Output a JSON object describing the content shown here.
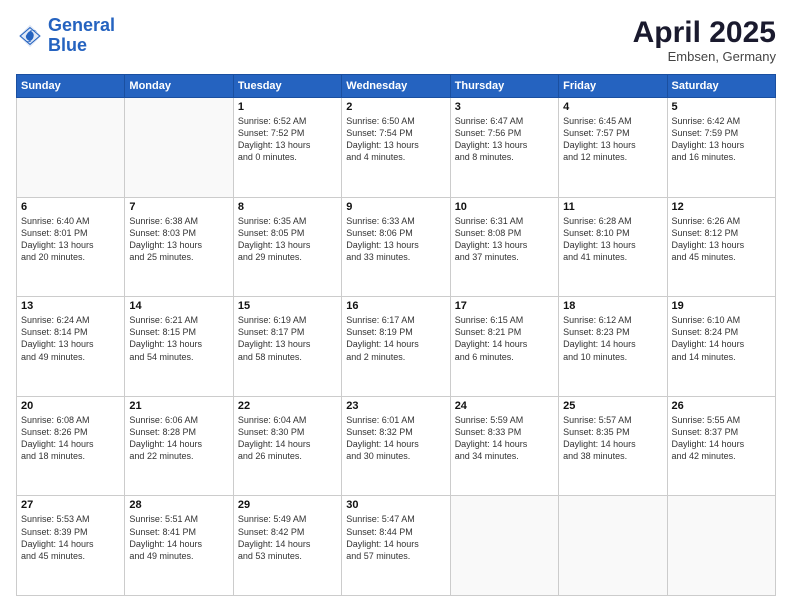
{
  "header": {
    "logo_line1": "General",
    "logo_line2": "Blue",
    "month": "April 2025",
    "location": "Embsen, Germany"
  },
  "weekdays": [
    "Sunday",
    "Monday",
    "Tuesday",
    "Wednesday",
    "Thursday",
    "Friday",
    "Saturday"
  ],
  "weeks": [
    [
      {
        "day": "",
        "info": ""
      },
      {
        "day": "",
        "info": ""
      },
      {
        "day": "1",
        "info": "Sunrise: 6:52 AM\nSunset: 7:52 PM\nDaylight: 13 hours\nand 0 minutes."
      },
      {
        "day": "2",
        "info": "Sunrise: 6:50 AM\nSunset: 7:54 PM\nDaylight: 13 hours\nand 4 minutes."
      },
      {
        "day": "3",
        "info": "Sunrise: 6:47 AM\nSunset: 7:56 PM\nDaylight: 13 hours\nand 8 minutes."
      },
      {
        "day": "4",
        "info": "Sunrise: 6:45 AM\nSunset: 7:57 PM\nDaylight: 13 hours\nand 12 minutes."
      },
      {
        "day": "5",
        "info": "Sunrise: 6:42 AM\nSunset: 7:59 PM\nDaylight: 13 hours\nand 16 minutes."
      }
    ],
    [
      {
        "day": "6",
        "info": "Sunrise: 6:40 AM\nSunset: 8:01 PM\nDaylight: 13 hours\nand 20 minutes."
      },
      {
        "day": "7",
        "info": "Sunrise: 6:38 AM\nSunset: 8:03 PM\nDaylight: 13 hours\nand 25 minutes."
      },
      {
        "day": "8",
        "info": "Sunrise: 6:35 AM\nSunset: 8:05 PM\nDaylight: 13 hours\nand 29 minutes."
      },
      {
        "day": "9",
        "info": "Sunrise: 6:33 AM\nSunset: 8:06 PM\nDaylight: 13 hours\nand 33 minutes."
      },
      {
        "day": "10",
        "info": "Sunrise: 6:31 AM\nSunset: 8:08 PM\nDaylight: 13 hours\nand 37 minutes."
      },
      {
        "day": "11",
        "info": "Sunrise: 6:28 AM\nSunset: 8:10 PM\nDaylight: 13 hours\nand 41 minutes."
      },
      {
        "day": "12",
        "info": "Sunrise: 6:26 AM\nSunset: 8:12 PM\nDaylight: 13 hours\nand 45 minutes."
      }
    ],
    [
      {
        "day": "13",
        "info": "Sunrise: 6:24 AM\nSunset: 8:14 PM\nDaylight: 13 hours\nand 49 minutes."
      },
      {
        "day": "14",
        "info": "Sunrise: 6:21 AM\nSunset: 8:15 PM\nDaylight: 13 hours\nand 54 minutes."
      },
      {
        "day": "15",
        "info": "Sunrise: 6:19 AM\nSunset: 8:17 PM\nDaylight: 13 hours\nand 58 minutes."
      },
      {
        "day": "16",
        "info": "Sunrise: 6:17 AM\nSunset: 8:19 PM\nDaylight: 14 hours\nand 2 minutes."
      },
      {
        "day": "17",
        "info": "Sunrise: 6:15 AM\nSunset: 8:21 PM\nDaylight: 14 hours\nand 6 minutes."
      },
      {
        "day": "18",
        "info": "Sunrise: 6:12 AM\nSunset: 8:23 PM\nDaylight: 14 hours\nand 10 minutes."
      },
      {
        "day": "19",
        "info": "Sunrise: 6:10 AM\nSunset: 8:24 PM\nDaylight: 14 hours\nand 14 minutes."
      }
    ],
    [
      {
        "day": "20",
        "info": "Sunrise: 6:08 AM\nSunset: 8:26 PM\nDaylight: 14 hours\nand 18 minutes."
      },
      {
        "day": "21",
        "info": "Sunrise: 6:06 AM\nSunset: 8:28 PM\nDaylight: 14 hours\nand 22 minutes."
      },
      {
        "day": "22",
        "info": "Sunrise: 6:04 AM\nSunset: 8:30 PM\nDaylight: 14 hours\nand 26 minutes."
      },
      {
        "day": "23",
        "info": "Sunrise: 6:01 AM\nSunset: 8:32 PM\nDaylight: 14 hours\nand 30 minutes."
      },
      {
        "day": "24",
        "info": "Sunrise: 5:59 AM\nSunset: 8:33 PM\nDaylight: 14 hours\nand 34 minutes."
      },
      {
        "day": "25",
        "info": "Sunrise: 5:57 AM\nSunset: 8:35 PM\nDaylight: 14 hours\nand 38 minutes."
      },
      {
        "day": "26",
        "info": "Sunrise: 5:55 AM\nSunset: 8:37 PM\nDaylight: 14 hours\nand 42 minutes."
      }
    ],
    [
      {
        "day": "27",
        "info": "Sunrise: 5:53 AM\nSunset: 8:39 PM\nDaylight: 14 hours\nand 45 minutes."
      },
      {
        "day": "28",
        "info": "Sunrise: 5:51 AM\nSunset: 8:41 PM\nDaylight: 14 hours\nand 49 minutes."
      },
      {
        "day": "29",
        "info": "Sunrise: 5:49 AM\nSunset: 8:42 PM\nDaylight: 14 hours\nand 53 minutes."
      },
      {
        "day": "30",
        "info": "Sunrise: 5:47 AM\nSunset: 8:44 PM\nDaylight: 14 hours\nand 57 minutes."
      },
      {
        "day": "",
        "info": ""
      },
      {
        "day": "",
        "info": ""
      },
      {
        "day": "",
        "info": ""
      }
    ]
  ]
}
